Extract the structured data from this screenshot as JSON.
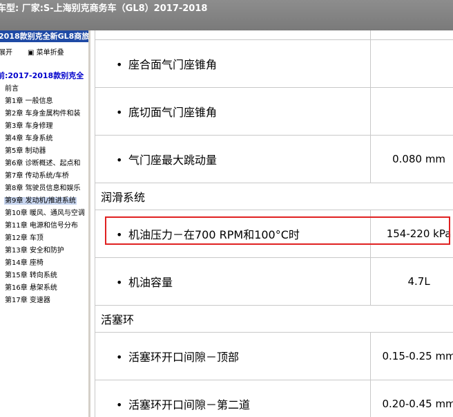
{
  "window": {
    "title": "车型: 厂家:S-上海别克商务车（GL8）2017-2018"
  },
  "sidebar": {
    "book_title": "2018款别克全新GL8商旅",
    "tools": {
      "expand": "展开",
      "collapse": "菜单折叠"
    },
    "model_title": "前:2017-2018款别克全",
    "items": [
      {
        "label": "前言"
      },
      {
        "label": "第1章 一般信息"
      },
      {
        "label": "第2章 车身金属构件和装"
      },
      {
        "label": "第3章 车身修理"
      },
      {
        "label": "第4章 车身系统"
      },
      {
        "label": "第5章 制动器"
      },
      {
        "label": "第6章 诊断概述、起点和"
      },
      {
        "label": "第7章 传动系统/车桥"
      },
      {
        "label": "第8章 驾驶员信息和娱乐"
      },
      {
        "label": "第9章 发动机/推进系统"
      },
      {
        "label": "第10章 暖风、通风与空调"
      },
      {
        "label": "第11章 电源和信号分布"
      },
      {
        "label": "第12章 车顶"
      },
      {
        "label": "第13章 安全和防护"
      },
      {
        "label": "第14章 座椅"
      },
      {
        "label": "第15章 转向系统"
      },
      {
        "label": "第16章 悬架系统"
      },
      {
        "label": "第17章 变速器"
      }
    ],
    "selected_index": 9
  },
  "spec_table": {
    "rows": [
      {
        "type": "item",
        "label": "座合面气门座锥角",
        "value": ""
      },
      {
        "type": "item",
        "label": "底切面气门座锥角",
        "value": ""
      },
      {
        "type": "item",
        "label": "气门座最大跳动量",
        "value": "0.080 mm"
      },
      {
        "type": "section",
        "label": "润滑系统"
      },
      {
        "type": "item",
        "label": "机油压力－在700 RPM和100°C时",
        "value": "154-220 kPa",
        "highlighted": true
      },
      {
        "type": "item",
        "label": "机油容量",
        "value": "4.7L"
      },
      {
        "type": "section",
        "label": "活塞环"
      },
      {
        "type": "item",
        "label": "活塞环开口间隙－顶部",
        "value": "0.15-0.25 mm"
      },
      {
        "type": "item",
        "label": "活塞环开口间隙－第二道",
        "value": "0.20-0.45 mm"
      }
    ]
  },
  "colors": {
    "highlight_border": "#e02020",
    "titlebar_bg": "#808080",
    "book_title_bg": "#1f4aa5",
    "model_title": "#0000cc"
  },
  "icons": {
    "expand": "expand-tree-icon",
    "collapse": "collapse-tree-icon",
    "bullet": "bullet-icon"
  }
}
